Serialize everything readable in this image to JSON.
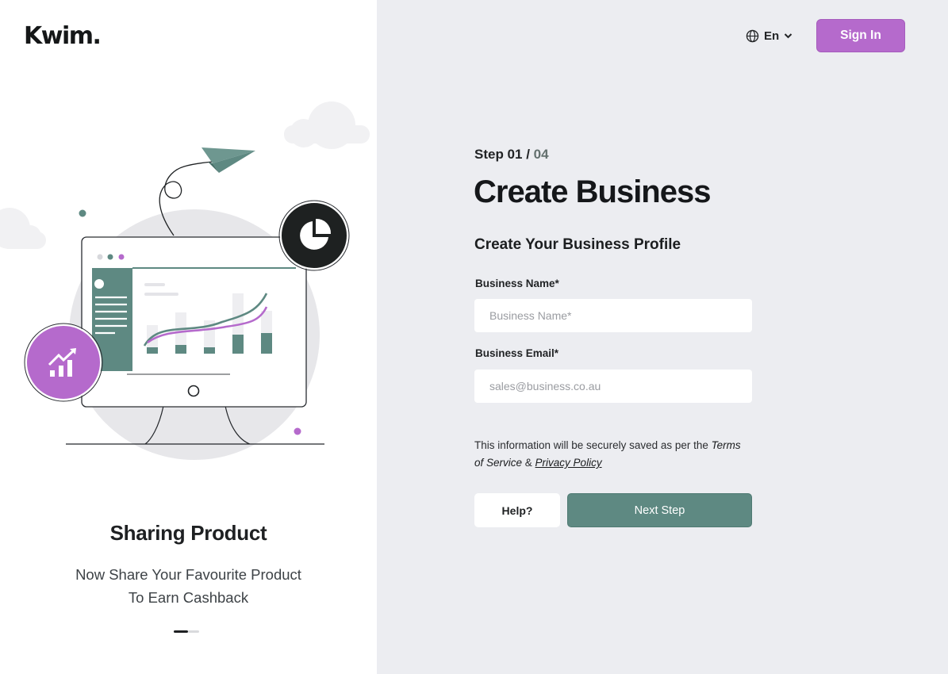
{
  "brand": {
    "logo_text": "Kwim."
  },
  "colors": {
    "accent_purple": "#b56acc",
    "accent_green": "#5e8982",
    "panel_bg": "#ecedf1",
    "text_dark": "#15171a"
  },
  "header": {
    "language_icon": "globe-icon",
    "language_label": "En",
    "language_chevron": "chevron-down-icon",
    "signin_label": "Sign In"
  },
  "carousel": {
    "title": "Sharing Product",
    "subtitle_line1": "Now Share Your Favourite Product",
    "subtitle_line2": "To Earn Cashback",
    "slides_total": 2,
    "active_slide": 1
  },
  "form": {
    "step_current": "Step 01",
    "step_sep": " / ",
    "step_total": "04",
    "title": "Create Business",
    "subtitle": "Create Your Business Profile",
    "business_name": {
      "label": "Business Name*",
      "placeholder": "Business Name*",
      "value": ""
    },
    "business_email": {
      "label": "Business Email*",
      "placeholder": "sales@business.co.au",
      "value": ""
    },
    "legal_prefix": "This information will be securely saved as per  the ",
    "legal_terms_1": "Terms",
    "legal_terms_2": "of Service",
    "legal_amp": " & ",
    "legal_privacy": "Privacy Policy",
    "help_label": "Help?",
    "next_label": "Next Step"
  }
}
